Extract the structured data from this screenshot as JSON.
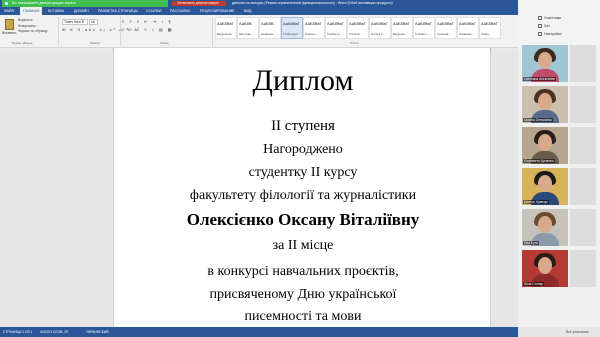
{
  "titlebar": {
    "share_status": "Вы показываете демонстрацию экрана",
    "stop_button": "Остановить демонстрацию",
    "doc_title": "диплом на конкурс (Режим ограниченной функциональности) - Word (Сбой активации продукта)"
  },
  "ribbon_tabs": [
    "ФАЙЛ",
    "ГЛАВНАЯ",
    "ВСТАВКА",
    "ДИЗАЙН",
    "РАЗМЕТКА СТРАНИЦЫ",
    "ССЫЛКИ",
    "РАССЫЛКИ",
    "РЕЦЕНЗИРОВАНИЕ",
    "ВИД"
  ],
  "ribbon": {
    "paste_label": "Вставить",
    "clipboard_items": [
      "Вырезать",
      "Копировать",
      "Формат по образцу"
    ],
    "clipboard_group": "Буфер обмена",
    "font_name": "Times New R",
    "font_size": "16",
    "font_group": "Шрифт",
    "paragraph_group": "Абзац",
    "styles_group": "Стили",
    "styles": [
      {
        "sample": "АаБбВвГ",
        "name": "Выделение"
      },
      {
        "sample": "АаБбВ",
        "name": "Заголово..."
      },
      {
        "sample": "АаБбВ",
        "name": "Название"
      },
      {
        "sample": "АаБбВвГ",
        "name": "¶ Обычный"
      },
      {
        "sample": "АаБбВвГ",
        "name": "Подзаго..."
      },
      {
        "sample": "АаБбВвГ",
        "name": "Слабое в..."
      },
      {
        "sample": "АаБбВвГ",
        "name": "Строгий"
      },
      {
        "sample": "АаБбВвГ",
        "name": "Цитата 2"
      },
      {
        "sample": "АаБбВвГ",
        "name": "Выделен..."
      },
      {
        "sample": "АаБбВвГ",
        "name": "Слабая с..."
      },
      {
        "sample": "АаБбВвГ",
        "name": "Сильная..."
      },
      {
        "sample": "АаБбВвГ",
        "name": "Название..."
      },
      {
        "sample": "АаБбВвГ",
        "name": "Абзац..."
      }
    ]
  },
  "document": {
    "title": "Диплом",
    "lines": [
      "ІІ ступеня",
      "Нагороджено",
      "студентку ІІ курсу",
      "факультету філології та журналістики",
      "Олексієнко Оксану Віталіївну",
      "за ІІ місце",
      "в конкурсі навчальних проєктів,",
      "присвяченому Дню української",
      "писемності та мови"
    ]
  },
  "statusbar": {
    "page": "СТРАНИЦА 1 ИЗ 1",
    "words": "ЧИСЛО СЛОВ: 29",
    "language": "УКРАИНСКИЙ"
  },
  "video_panel": {
    "header": [
      "Участники",
      "Чат",
      "Настройки"
    ],
    "participants": [
      {
        "name": "Светлана Алексеева",
        "bg": "#a0c6d4",
        "hair": "#3a2a22",
        "body": "#c04b6a"
      },
      {
        "name": "Оксана Олексієнко",
        "bg": "#cbbfae",
        "hair": "#4a3222",
        "body": "#5a6a8a"
      },
      {
        "name": "Єлизавета Бугаєнко",
        "bg": "#b8a590",
        "hair": "#2a1e18",
        "body": "#6b5b4b"
      },
      {
        "name": "Дмитро Кравчук",
        "bg": "#d9b35a",
        "hair": "#1c1a18",
        "body": "#2b4a7a"
      },
      {
        "name": "Ліза Бута",
        "bg": "#c8c2bc",
        "hair": "#6b4a30",
        "body": "#8a9aaa"
      },
      {
        "name": "Юлія Столяр",
        "bg": "#b63a34",
        "hair": "#2a1c14",
        "body": "#8c2a2a"
      }
    ],
    "footer": "Все участники"
  },
  "colors": {
    "word_blue": "#2b579a",
    "share_green": "#3fbf4f",
    "stop_red": "#c0392b"
  }
}
